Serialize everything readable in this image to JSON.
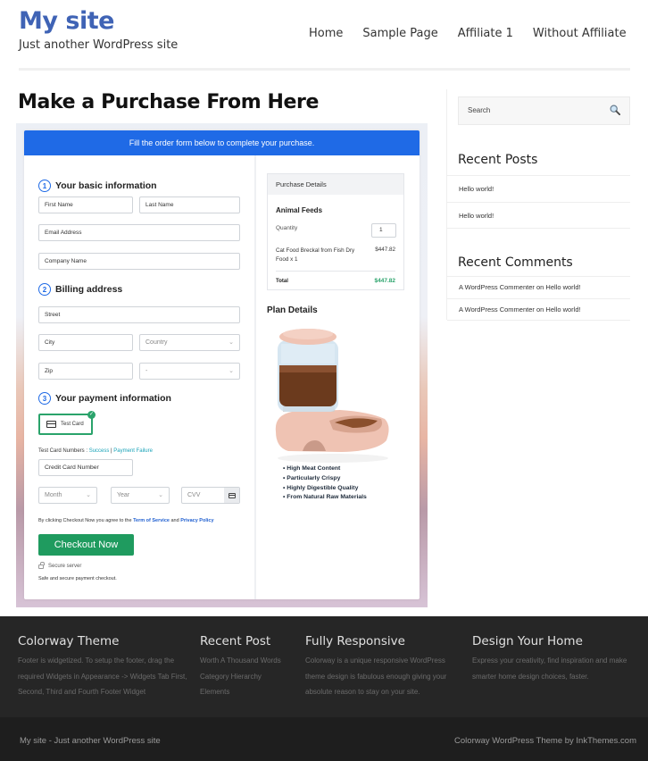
{
  "header": {
    "site_title": "My site",
    "tagline": "Just another WordPress site",
    "nav": [
      "Home",
      "Sample Page",
      "Affiliate 1",
      "Without Affiliate"
    ]
  },
  "page": {
    "title": "Make a Purchase From Here"
  },
  "checkout": {
    "banner": "Fill the order form below to complete your purchase.",
    "step1": {
      "num": "1",
      "title": "Your basic information"
    },
    "step2": {
      "num": "2",
      "title": "Billing address"
    },
    "step3": {
      "num": "3",
      "title": "Your payment information"
    },
    "fields": {
      "first_name": "First Name",
      "last_name": "Last Name",
      "email": "Email Address",
      "company": "Company Name",
      "street": "Street",
      "city": "City",
      "country": "Country",
      "zip": "Zip",
      "state": "-",
      "card_number": "Credit Card Number",
      "month": "Month",
      "year": "Year",
      "cvv": "CVV"
    },
    "payment_method": "Test Card",
    "test_numbers_label": "Test Card Numbers : ",
    "test_success": "Success",
    "test_separator": " | ",
    "test_failure": "Payment Failure",
    "agree_prefix": "By clicking Checkout Now you agree to the ",
    "terms": "Term of Service",
    "agree_and": " and ",
    "privacy": "Privacy Policy",
    "checkout_button": "Checkout Now",
    "secure_server": "Secure server",
    "safe_text": "Safe and secure payment checkout."
  },
  "purchase": {
    "heading": "Purchase Details",
    "product": "Animal Feeds",
    "quantity_label": "Quantity",
    "quantity": "1",
    "item": "Cat Food Breckal from Fish Dry Food x 1",
    "item_price": "$447.82",
    "total_label": "Total",
    "total": "$447.82",
    "plan_title": "Plan Details",
    "features": [
      "High Meat Content",
      "Particularly Crispy",
      "Highly Digestible Quality",
      "From Natural Raw Materials"
    ]
  },
  "sidebar": {
    "search_placeholder": "Search",
    "recent_posts_title": "Recent Posts",
    "recent_posts": [
      "Hello world!",
      "Hello world!"
    ],
    "recent_comments_title": "Recent Comments",
    "recent_comments": [
      "A WordPress Commenter on Hello world!",
      "A WordPress Commenter on Hello world!"
    ]
  },
  "footer": {
    "columns": [
      {
        "title": "Colorway Theme",
        "text": "Footer is widgetized. To setup the footer, drag the required Widgets in Appearance -> Widgets Tab First, Second, Third and Fourth Footer Widget"
      },
      {
        "title": "Recent Post",
        "links": [
          "Worth A Thousand Words",
          "Category Hierarchy",
          "Elements"
        ]
      },
      {
        "title": "Fully Responsive",
        "text": "Colorway is a unique responsive WordPress theme design is fabulous enough giving your absolute reason to stay on your site."
      },
      {
        "title": "Design Your Home",
        "text": "Express your creativity, find inspiration and make smarter home design choices, faster."
      }
    ],
    "bottom_left": "My site - Just another WordPress site",
    "bottom_right": "Colorway WordPress Theme by InkThemes.com"
  },
  "colors": {
    "brand": "#3f63b5",
    "banner": "#1f6ae6",
    "checkout": "#1f9b5f",
    "success": "#2aa36b"
  }
}
